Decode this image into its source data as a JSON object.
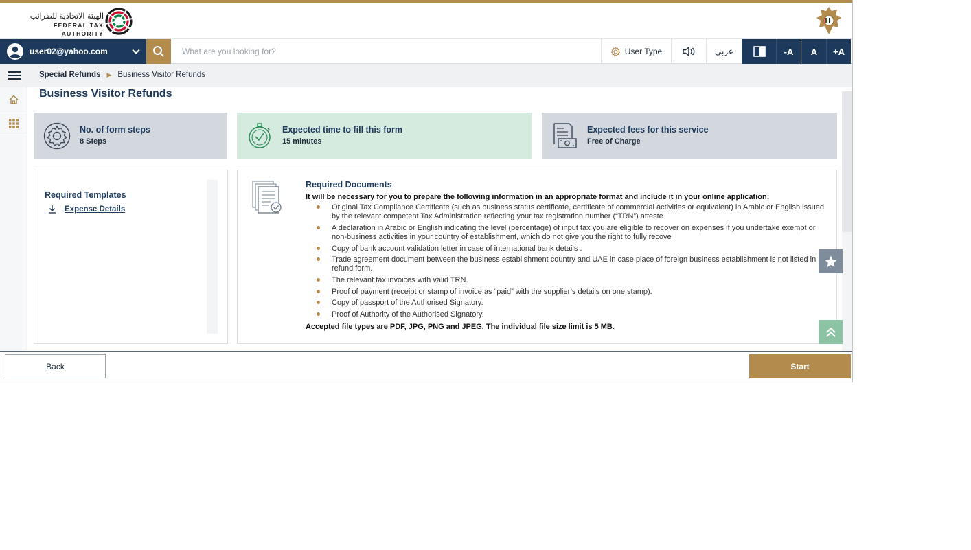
{
  "header": {
    "logo_ar": "الهيئة الاتحادية للضرائب",
    "logo_en": "FEDERAL TAX AUTHORITY",
    "logo_icon": "fta-logo-icon",
    "emblem_icon": "uae-emblem-icon"
  },
  "navbar": {
    "user_email": "user02@yahoo.com",
    "search_placeholder": "What are you looking for?",
    "search_value": "",
    "user_type_label": "User Type",
    "language_label": "عربي",
    "font_decrease_label": "-A",
    "font_normal_label": "A",
    "font_increase_label": "+A"
  },
  "breadcrumb": {
    "parent": "Special Refunds",
    "current": "Business Visitor Refunds"
  },
  "page": {
    "title": "Business Visitor Refunds"
  },
  "info_cards": [
    {
      "title": "No. of form steps",
      "value": "8 Steps",
      "icon": "gear-icon"
    },
    {
      "title": "Expected time to fill this form",
      "value": "15 minutes",
      "icon": "stopwatch-icon"
    },
    {
      "title": "Expected fees for this service",
      "value": "Free of Charge",
      "icon": "invoice-icon"
    }
  ],
  "templates": {
    "title": "Required Templates",
    "items": [
      {
        "label": "Expense Details",
        "icon": "download-icon"
      }
    ]
  },
  "documents": {
    "title": "Required Documents",
    "intro": "It will be necessary for you to prepare the following information in an appropriate format and include it in your online application:",
    "items": [
      "Original Tax Compliance Certificate (such as business status certificate, certificate of commercial activities or equivalent) in Arabic or English issued by the relevant competent Tax Administration reflecting your tax registration number (“TRN”) atteste",
      "A declaration in Arabic or English indicating the level (percentage) of input tax you are eligible to recover on expenses if you undertake exempt or non-business activities in your country of establishment, which do not give you the right to fully recove",
      "Copy of bank account validation letter in case of international bank details .",
      "Trade agreement document between the business establishment country and UAE in case place of foreign business establishment is not listed in refund form.",
      "The relevant tax invoices with valid TRN.",
      "Proof of payment (receipt or stamp of invoice as “paid” with the supplier’s details on one stamp).",
      "Copy of passport of the Authorised Signatory.",
      "Proof of Authority of the Authorised Signatory."
    ],
    "footer": "Accepted file types are PDF, JPG, PNG and JPEG. The individual file size limit is 5 MB."
  },
  "footer": {
    "back_label": "Back",
    "start_label": "Start"
  },
  "colors": {
    "primary": "#1d3a5c",
    "gold": "#b38b4d",
    "green_card": "#d6ebe0",
    "grey_card": "#d3d8df"
  }
}
